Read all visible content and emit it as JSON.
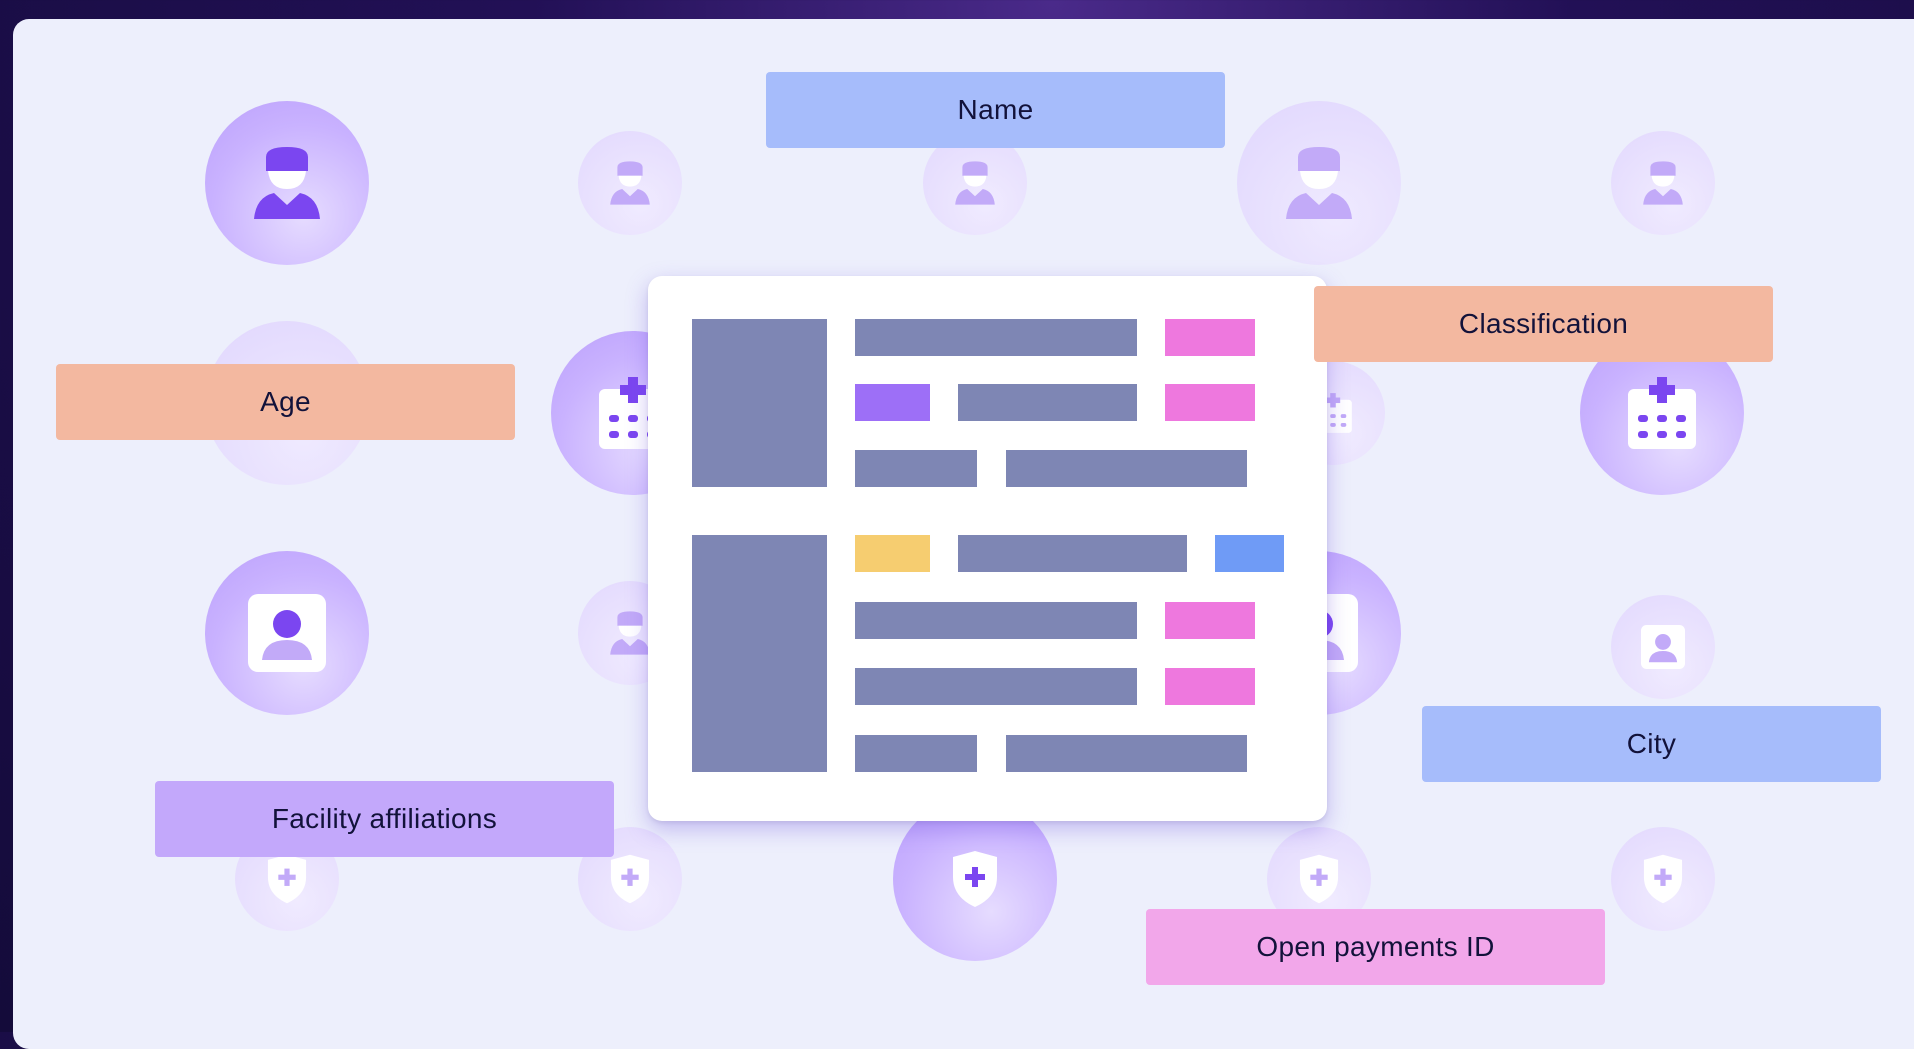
{
  "labels": {
    "name": "Name",
    "classification": "Classification",
    "age": "Age",
    "city": "City",
    "facility_affiliations": "Facility affiliations",
    "open_payments_id": "Open payments ID"
  },
  "colors": {
    "blue_label": "#a6bcfb",
    "salmon_label": "#f3b8a0",
    "purple_label": "#c3a8fb",
    "pink_label": "#f2a7ea",
    "accent_purple": "#7b46f0",
    "panel_bg": "#edeffc"
  },
  "icons": [
    "doctor-icon",
    "hospital-icon",
    "profile-icon",
    "shield-plus-icon"
  ]
}
